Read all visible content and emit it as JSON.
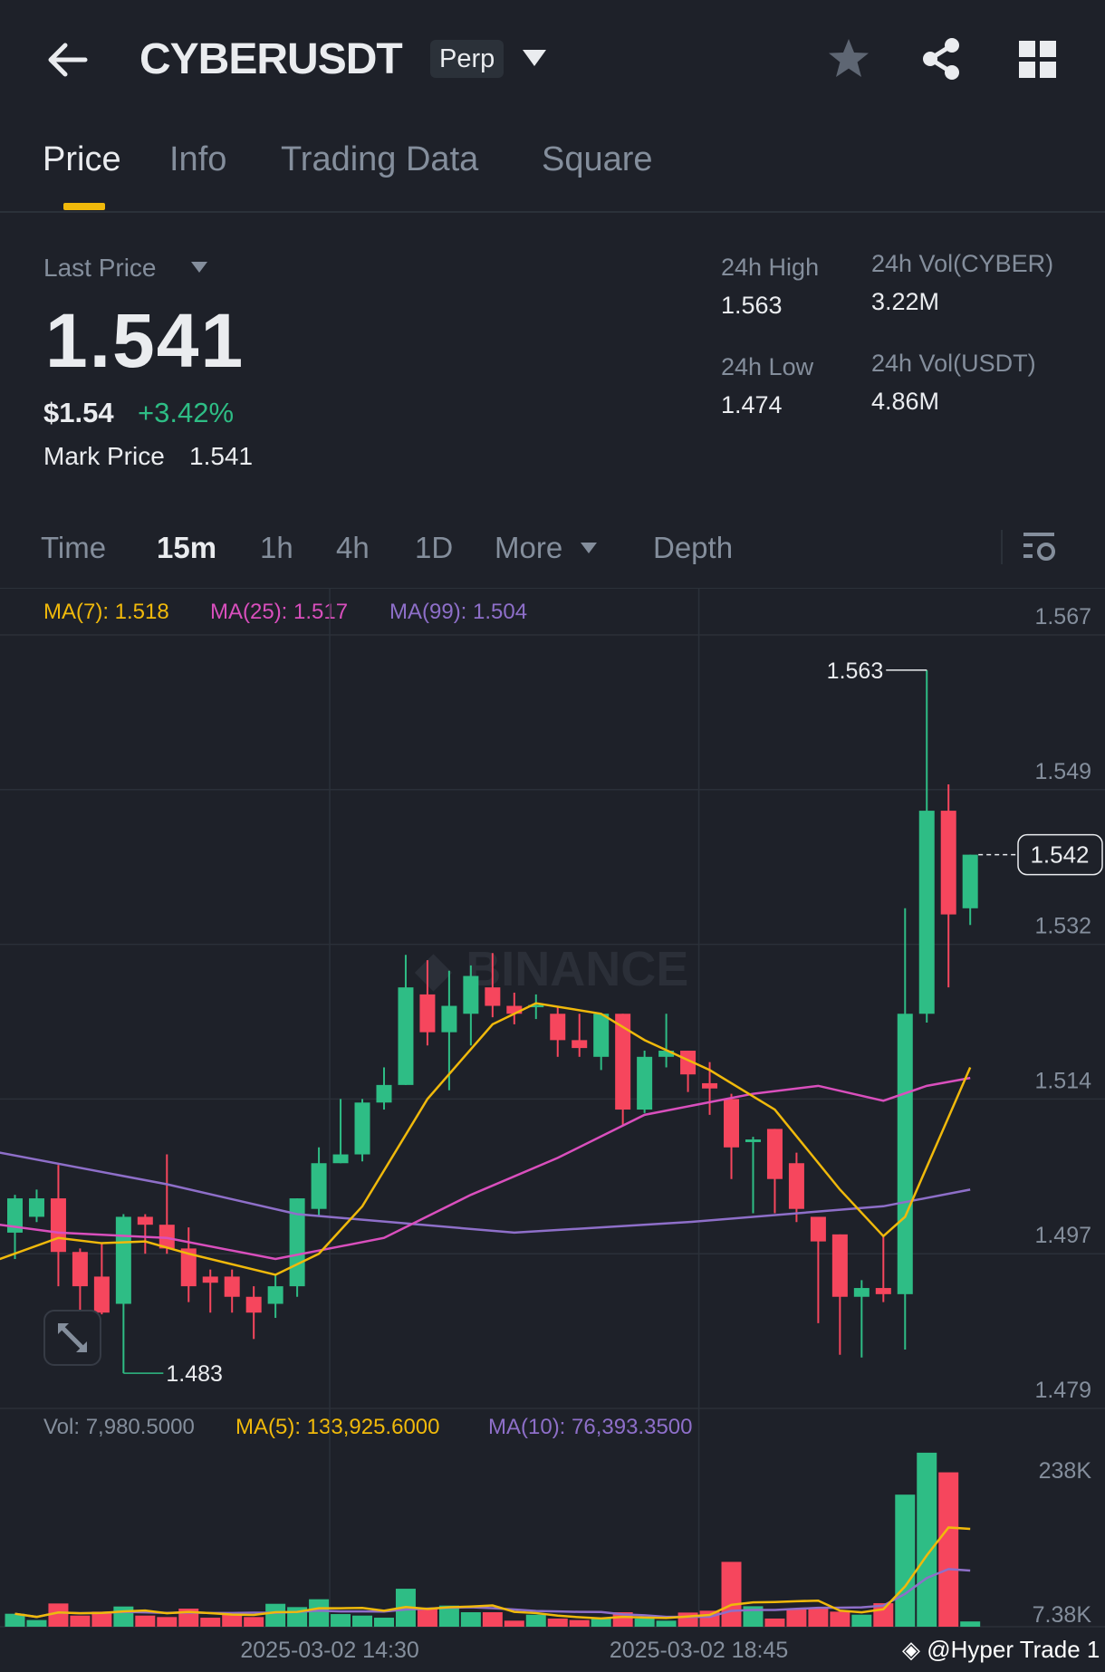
{
  "header": {
    "symbol": "CYBERUSDT",
    "badge": "Perp"
  },
  "tabs": [
    "Price",
    "Info",
    "Trading Data",
    "Square"
  ],
  "active_tab": 0,
  "ticker": {
    "last_price_label": "Last Price",
    "last_price": "1.541",
    "usd_price": "$1.54",
    "change": "+3.42%",
    "mark_price_label": "Mark Price",
    "mark_price": "1.541",
    "high_label": "24h High",
    "high": "1.563",
    "low_label": "24h Low",
    "low": "1.474",
    "vol_base_label": "24h Vol(CYBER)",
    "vol_base": "3.22M",
    "vol_quote_label": "24h Vol(USDT)",
    "vol_quote": "4.86M"
  },
  "timeframes": {
    "time": "Time",
    "m15": "15m",
    "h1": "1h",
    "h4": "4h",
    "d1": "1D",
    "more": "More",
    "depth": "Depth"
  },
  "ma_legend": {
    "ma7": "MA(7): 1.518",
    "ma25": "MA(25): 1.517",
    "ma99": "MA(99): 1.504"
  },
  "vol_legend": {
    "vol": "Vol: 7,980.5000",
    "ma5": "MA(5): 133,925.6000",
    "ma10": "MA(10): 76,393.3500"
  },
  "watermark": "@Hyper Trade 1",
  "logo_watermark": "BINANCE",
  "colors": {
    "bg": "#1e2129",
    "up": "#2ebd85",
    "down": "#f6465d",
    "ma7": "#f0b90b",
    "ma25": "#d94fbd",
    "ma99": "#8e6fc9",
    "accent": "#f0b90b"
  },
  "chart_data": {
    "type": "candlestick",
    "interval": "15m",
    "ylim": [
      1.479,
      1.567
    ],
    "y_ticks": [
      "1.567",
      "1.549",
      "1.532",
      "1.514",
      "1.497",
      "1.479"
    ],
    "x_ticks": [
      {
        "index": 14.5,
        "label": "2025-03-02 14:30"
      },
      {
        "index": 31.5,
        "label": "2025-03-02 18:45"
      }
    ],
    "high_marker": {
      "index": 42,
      "label": "1.563"
    },
    "low_marker": {
      "index": 5,
      "label": "1.483"
    },
    "current_price": "1.542",
    "ohlc": [
      [
        1.499,
        1.5033,
        1.496,
        1.5029
      ],
      [
        1.5008,
        1.5039,
        1.5002,
        1.5029
      ],
      [
        1.5029,
        1.5067,
        1.4929,
        1.4968
      ],
      [
        1.4968,
        1.4972,
        1.4899,
        1.4929
      ],
      [
        1.494,
        1.4978,
        1.4897,
        1.4899
      ],
      [
        1.4909,
        1.5011,
        1.483,
        1.5008
      ],
      [
        1.5008,
        1.5011,
        1.4966,
        1.4999
      ],
      [
        1.4999,
        1.5079,
        1.4966,
        1.4972
      ],
      [
        1.4972,
        1.4996,
        1.4911,
        1.4929
      ],
      [
        1.494,
        1.4948,
        1.4899,
        1.4933
      ],
      [
        1.494,
        1.4948,
        1.4899,
        1.4917
      ],
      [
        1.4917,
        1.4929,
        1.4869,
        1.4899
      ],
      [
        1.4909,
        1.4942,
        1.4893,
        1.4929
      ],
      [
        1.4929,
        1.5029,
        1.4917,
        1.5029
      ],
      [
        1.5017,
        1.5087,
        1.5008,
        1.5069
      ],
      [
        1.5069,
        1.5142,
        1.5069,
        1.5079
      ],
      [
        1.5079,
        1.5142,
        1.5071,
        1.5138
      ],
      [
        1.5138,
        1.5178,
        1.513,
        1.5158
      ],
      [
        1.5158,
        1.5306,
        1.5158,
        1.5269
      ],
      [
        1.5261,
        1.53,
        1.5203,
        1.5218
      ],
      [
        1.5218,
        1.5288,
        1.5152,
        1.5248
      ],
      [
        1.5239,
        1.5294,
        1.5203,
        1.5282
      ],
      [
        1.5269,
        1.5308,
        1.5235,
        1.5248
      ],
      [
        1.5248,
        1.5263,
        1.5227,
        1.5239
      ],
      [
        1.5248,
        1.5261,
        1.5233,
        1.5249
      ],
      [
        1.5239,
        1.5248,
        1.519,
        1.5209
      ],
      [
        1.5209,
        1.5239,
        1.519,
        1.52
      ],
      [
        1.519,
        1.5239,
        1.5175,
        1.5239
      ],
      [
        1.5239,
        1.5239,
        1.5112,
        1.513
      ],
      [
        1.513,
        1.5197,
        1.5126,
        1.519
      ],
      [
        1.519,
        1.5239,
        1.5178,
        1.5197
      ],
      [
        1.5197,
        1.5197,
        1.515,
        1.517
      ],
      [
        1.516,
        1.5184,
        1.5124,
        1.5154
      ],
      [
        1.5142,
        1.5148,
        1.5051,
        1.5087
      ],
      [
        1.5093,
        1.5099,
        1.5012,
        1.5096
      ],
      [
        1.5108,
        1.5108,
        1.5012,
        1.5051
      ],
      [
        1.5069,
        1.5081,
        1.5002,
        1.5017
      ],
      [
        1.5008,
        1.5008,
        1.4887,
        1.498
      ],
      [
        1.4988,
        1.4988,
        1.4851,
        1.4917
      ],
      [
        1.4917,
        1.4936,
        1.4848,
        1.4927
      ],
      [
        1.4927,
        1.4988,
        1.4911,
        1.492
      ],
      [
        1.492,
        1.5359,
        1.4857,
        1.5239
      ],
      [
        1.5239,
        1.563,
        1.5229,
        1.547
      ],
      [
        1.547,
        1.55,
        1.5269,
        1.5352
      ],
      [
        1.5359,
        1.542,
        1.534,
        1.542
      ]
    ],
    "ma7": [
      [
        -0.7,
        1.496
      ],
      [
        2,
        1.4984
      ],
      [
        4,
        1.4978
      ],
      [
        6,
        1.498
      ],
      [
        8,
        1.4966
      ],
      [
        12,
        1.4942
      ],
      [
        14,
        1.4966
      ],
      [
        16,
        1.502
      ],
      [
        19,
        1.5142
      ],
      [
        22,
        1.5227
      ],
      [
        24,
        1.5251
      ],
      [
        27,
        1.5239
      ],
      [
        29,
        1.5209
      ],
      [
        32,
        1.5175
      ],
      [
        35,
        1.513
      ],
      [
        38,
        1.5039
      ],
      [
        40,
        1.4986
      ],
      [
        41,
        1.5008
      ],
      [
        42.5,
        1.5093
      ],
      [
        44,
        1.5178
      ]
    ],
    "ma25": [
      [
        -0.7,
        1.4999
      ],
      [
        2,
        1.499
      ],
      [
        7,
        1.4984
      ],
      [
        12,
        1.496
      ],
      [
        17,
        1.4984
      ],
      [
        21,
        1.5033
      ],
      [
        25,
        1.5075
      ],
      [
        29,
        1.5124
      ],
      [
        34,
        1.5148
      ],
      [
        37,
        1.5157
      ],
      [
        40,
        1.514
      ],
      [
        42,
        1.5157
      ],
      [
        44,
        1.5166
      ]
    ],
    "ma99": [
      [
        -0.7,
        1.5081
      ],
      [
        7,
        1.5045
      ],
      [
        13,
        1.5011
      ],
      [
        23,
        1.499
      ],
      [
        31,
        1.5002
      ],
      [
        40,
        1.502
      ],
      [
        44,
        1.5039
      ]
    ],
    "volume": {
      "y_ticks": [
        "238K",
        "7.38K"
      ],
      "values": [
        19700,
        10100,
        35300,
        16900,
        22900,
        30700,
        16900,
        14700,
        27500,
        13700,
        19200,
        14700,
        34800,
        29800,
        41700,
        19200,
        16900,
        13700,
        57700,
        27500,
        32100,
        22000,
        22000,
        9200,
        18300,
        12400,
        10100,
        12400,
        22000,
        12400,
        9200,
        21500,
        24300,
        98500,
        31100,
        12400,
        27500,
        28400,
        22900,
        18300,
        35700,
        200600,
        264300,
        234500,
        7980
      ]
    }
  }
}
